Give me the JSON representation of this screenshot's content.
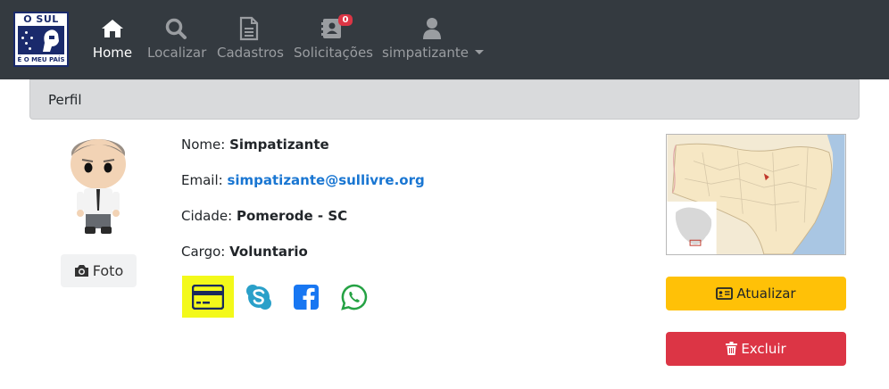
{
  "brand": {
    "top_text": "O SUL",
    "bottom_text": "É O MEU PAÍS"
  },
  "nav": {
    "items": [
      {
        "label": "Home",
        "icon": "home-icon",
        "active": true
      },
      {
        "label": "Localizar",
        "icon": "search-icon",
        "active": false
      },
      {
        "label": "Cadastros",
        "icon": "document-icon",
        "active": false
      },
      {
        "label": "Solicitações",
        "icon": "contact-book-icon",
        "active": false,
        "badge": "0"
      },
      {
        "label": "simpatizante",
        "icon": "user-icon",
        "active": false,
        "dropdown": true
      }
    ]
  },
  "card": {
    "header": "Perfil"
  },
  "profile": {
    "foto_label": "Foto",
    "name_label": "Nome:",
    "name_value": "Simpatizante",
    "email_label": "Email:",
    "email_value": "simpatizante@sullivre.org",
    "city_label": "Cidade:",
    "city_value": "Pomerode - SC",
    "role_label": "Cargo:",
    "role_value": "Voluntario"
  },
  "social": [
    {
      "icon": "credit-card-icon",
      "highlighted": true
    },
    {
      "icon": "skype-icon"
    },
    {
      "icon": "facebook-icon"
    },
    {
      "icon": "whatsapp-icon"
    }
  ],
  "actions": {
    "update_label": "Atualizar",
    "delete_label": "Excluir"
  },
  "colors": {
    "navbar": "#343a40",
    "warning": "#ffc107",
    "danger": "#dc3545",
    "link": "#1976d2",
    "highlight": "#f3f91a"
  }
}
